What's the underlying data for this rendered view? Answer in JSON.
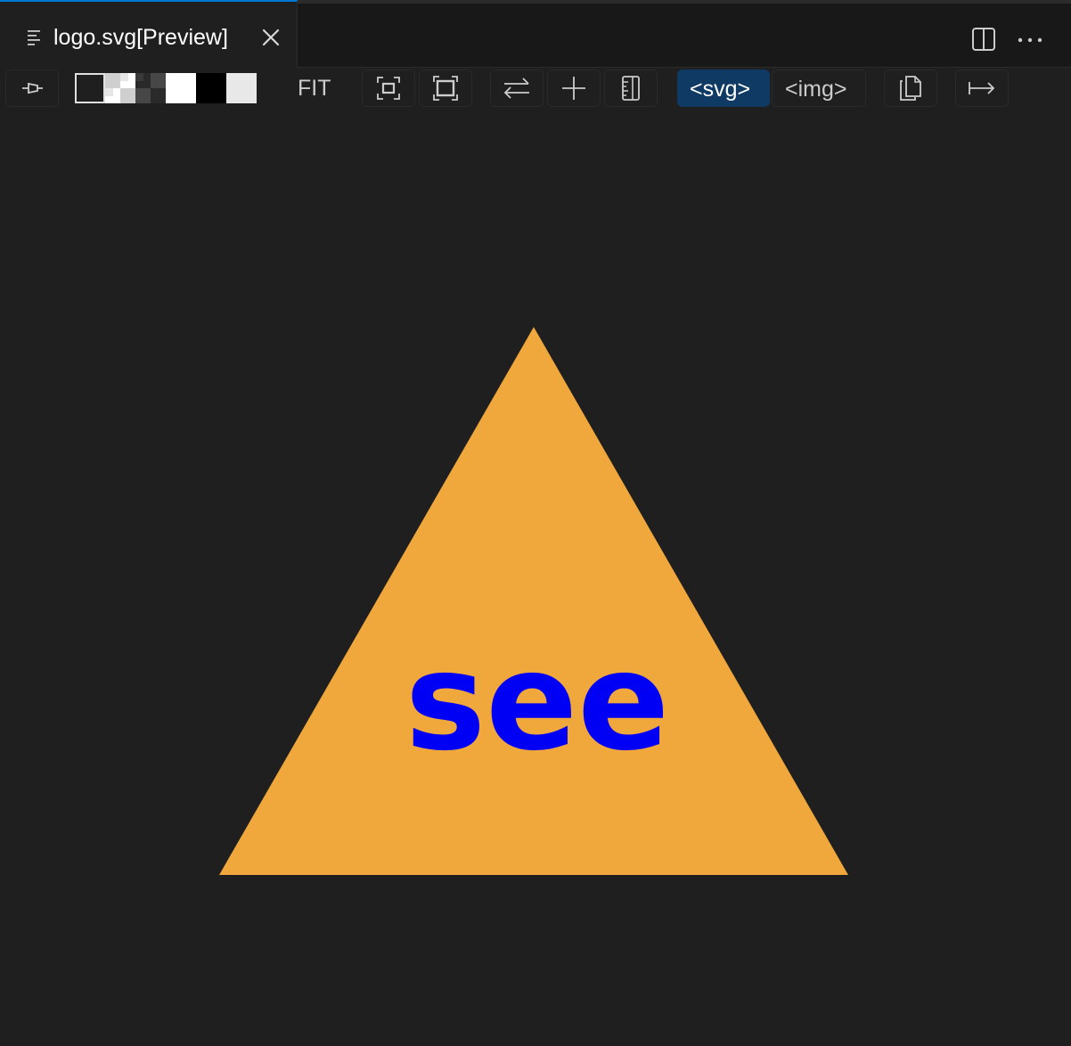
{
  "tab": {
    "title": "logo.svg[Preview]",
    "file_icon": "file-lines-icon",
    "close_icon": "close-icon"
  },
  "editor_actions": {
    "split_icon": "split-editor-icon",
    "more_icon": "more-actions-icon"
  },
  "toolbar": {
    "pin_icon": "pin-icon",
    "background_swatches": [
      {
        "name": "dark",
        "color": "#1f1f1f"
      },
      {
        "name": "light-checkerboard",
        "color": "#cccccc"
      },
      {
        "name": "dark-checkerboard",
        "color": "#3a3a3a"
      },
      {
        "name": "white",
        "color": "#ffffff"
      },
      {
        "name": "black",
        "color": "#000000"
      },
      {
        "name": "light-gray",
        "color": "#e8e8e8"
      }
    ],
    "fit_label": "FIT",
    "zoom_in_icon": "fit-center-icon",
    "zoom_frame_icon": "fit-frame-icon",
    "swap_icon": "swap-arrows-icon",
    "crosshair_icon": "plus-crosshair-icon",
    "ruler_icon": "ruler-icon",
    "svg_label": "<svg>",
    "img_label": "<img>",
    "copy_icon": "copy-icon",
    "export_icon": "arrow-right-icon"
  },
  "preview": {
    "background": "#1f1f1f",
    "shape": "triangle",
    "shape_color": "#f0a83c",
    "text": "see",
    "text_color": "#0000f5"
  },
  "colors": {
    "accent": "#0078d4",
    "active_button": "#0e3a64"
  }
}
